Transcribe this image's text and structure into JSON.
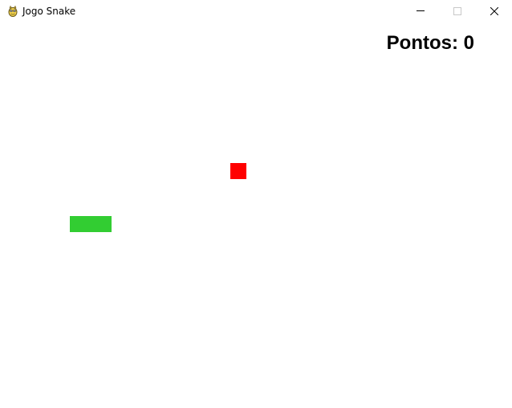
{
  "window": {
    "title": "Jogo Snake",
    "app_icon": "pygame-snake-icon",
    "controls": {
      "minimize_icon": "minimize-icon",
      "maximize_icon": "maximize-icon",
      "close_icon": "close-icon"
    }
  },
  "game": {
    "score_label": "Pontos: 0",
    "colors": {
      "background": "#ffffff",
      "snake": "#32cd32",
      "food": "#ff0000",
      "score_text": "#000000"
    }
  }
}
